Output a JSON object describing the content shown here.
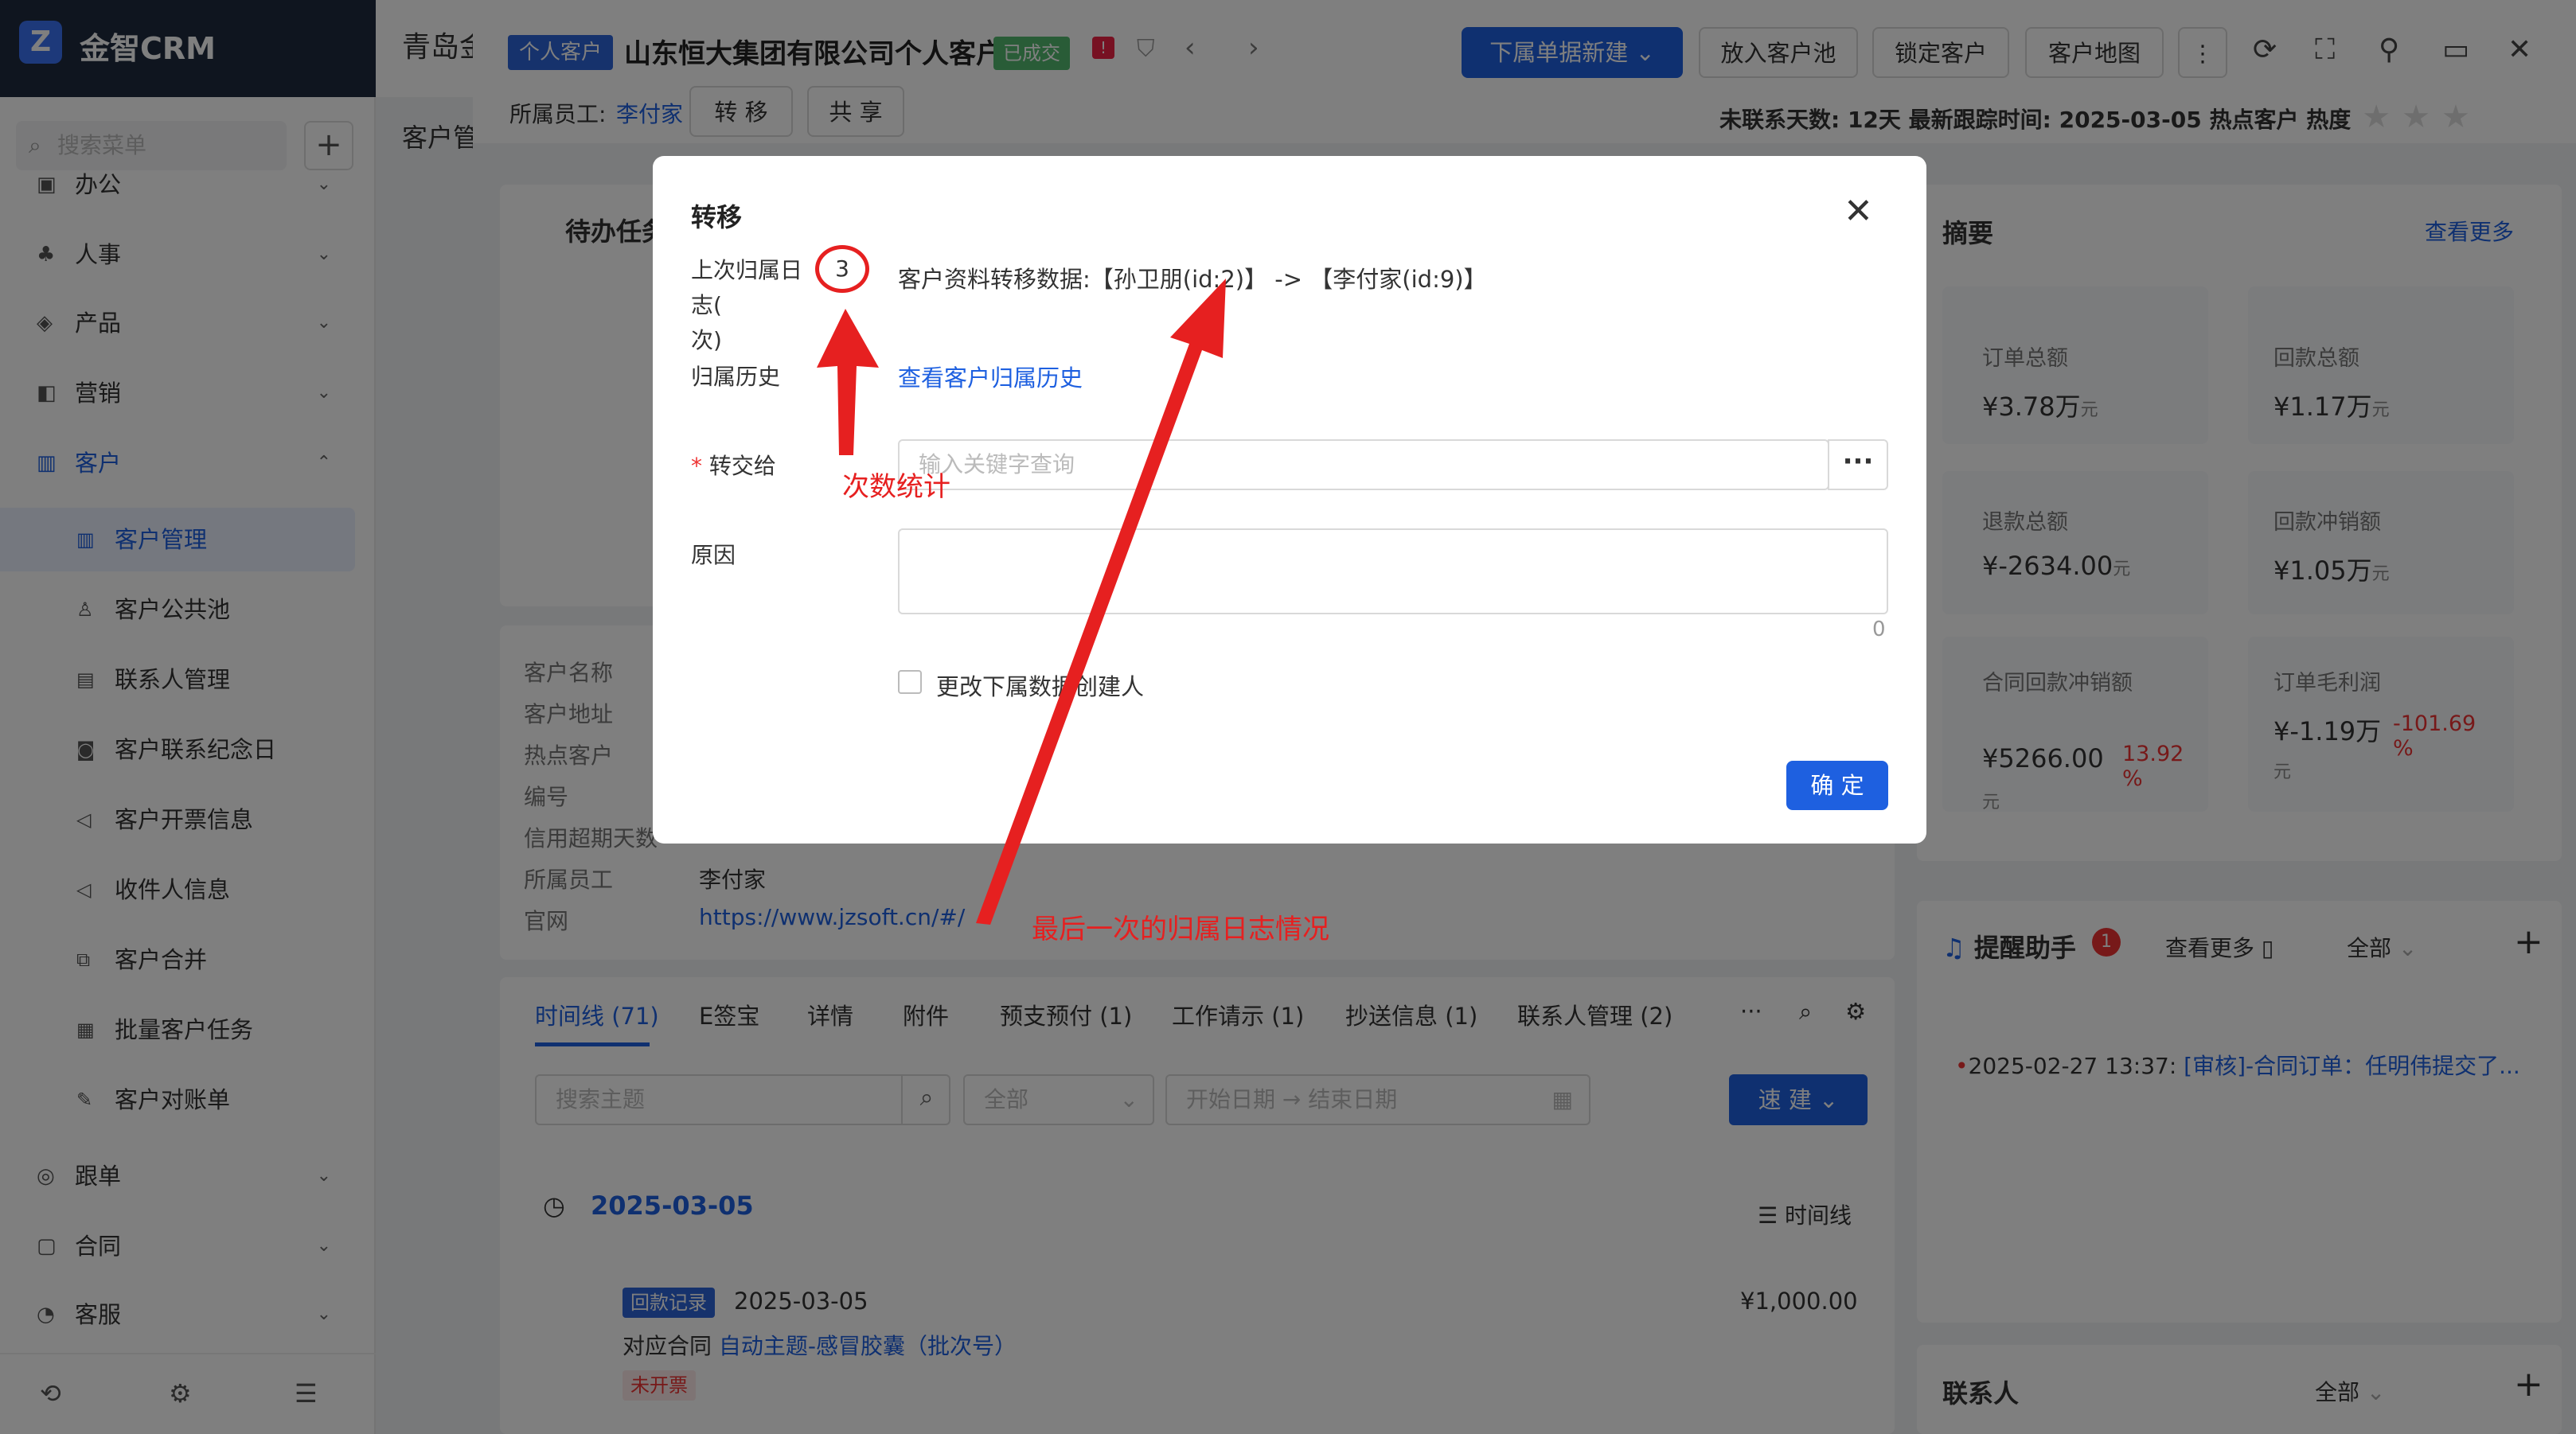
{
  "sidebar": {
    "brand": "金智CRM",
    "search_placeholder": "搜索菜单",
    "items": [
      {
        "label": "办公",
        "icon": "briefcase-icon"
      },
      {
        "label": "人事",
        "icon": "users-icon"
      },
      {
        "label": "产品",
        "icon": "box-icon"
      },
      {
        "label": "营销",
        "icon": "megaphone-icon"
      },
      {
        "label": "客户",
        "icon": "chart-icon"
      },
      {
        "label": "跟单",
        "icon": "target-icon"
      },
      {
        "label": "合同",
        "icon": "document-icon"
      },
      {
        "label": "客服",
        "icon": "headset-icon"
      }
    ],
    "sub_items": [
      {
        "label": "客户管理"
      },
      {
        "label": "客户公共池"
      },
      {
        "label": "联系人管理"
      },
      {
        "label": "客户联系纪念日"
      },
      {
        "label": "客户开票信息"
      },
      {
        "label": "收件人信息"
      },
      {
        "label": "客户合并"
      },
      {
        "label": "批量客户任务"
      },
      {
        "label": "客户对账单"
      }
    ]
  },
  "topbar": {
    "company": "青岛金",
    "breadcrumb": "客户管"
  },
  "drawer": {
    "tag_personal": "个人客户",
    "customer_name": "山东恒大集团有限公司个人客户",
    "tag_deal": "已成交",
    "buttons": {
      "new_sub": "下属单据新建",
      "to_pool": "放入客户池",
      "lock": "锁定客户",
      "map": "客户地图",
      "transfer": "转 移",
      "share": "共 享"
    },
    "employee_label": "所属员工:",
    "employee_name": "李付家",
    "stats": "未联系天数: 12天  最新跟踪时间: 2025-03-05",
    "hot_label": "热点客户",
    "heat_label": "热度",
    "todo_title": "待办任务",
    "info": [
      {
        "k": "客户名称",
        "v": ""
      },
      {
        "k": "客户地址",
        "v": ""
      },
      {
        "k": "热点客户",
        "v": ""
      },
      {
        "k": "编号",
        "v": ""
      },
      {
        "k": "信用超期天数",
        "v": ""
      },
      {
        "k": "所属员工",
        "v": "李付家"
      },
      {
        "k": "官网",
        "v": "https://www.jzsoft.cn/#/"
      }
    ],
    "tabs": [
      "时间线 (71)",
      "E签宝",
      "详情",
      "附件",
      "预支预付 (1)",
      "工作请示 (1)",
      "抄送信息 (1)",
      "联系人管理 (2)",
      "···"
    ],
    "timeline": {
      "search_placeholder": "搜索主题",
      "filter": "全部",
      "start_placeholder": "开始日期",
      "end_placeholder": "结束日期",
      "quick_btn": "速 建",
      "date": "2025-03-05",
      "view_label": "时间线",
      "record_tag": "回款记录",
      "record_date": "2025-03-05",
      "record_amount": "¥1,000.00",
      "contract_prefix": "对应合同",
      "contract_link": "自动主题-感冒胶囊（批次号）",
      "unbilled": "未开票"
    }
  },
  "summary": {
    "title": "摘要",
    "more": "查看更多",
    "cards": [
      {
        "k": "订单总额",
        "v": "¥3.78万",
        "unit": "元",
        "pct": ""
      },
      {
        "k": "回款总额",
        "v": "¥1.17万",
        "unit": "元",
        "pct": ""
      },
      {
        "k": "退款总额",
        "v": "¥-2634.00",
        "unit": "元",
        "pct": ""
      },
      {
        "k": "回款冲销额",
        "v": "¥1.05万",
        "unit": "元",
        "pct": ""
      },
      {
        "k": "合同回款冲销额",
        "v": "¥5266.00",
        "unit": "元",
        "pct": "13.92 %"
      },
      {
        "k": "订单毛利润",
        "v": "¥-1.19万",
        "unit": "元",
        "pct": "-101.69 %"
      }
    ]
  },
  "reminder": {
    "title": "提醒助手",
    "badge": "1",
    "more": "查看更多",
    "filter": "全部",
    "item_time": "2025-02-27 13:37:",
    "item_text": "[审核]-合同订单：任明伟提交了..."
  },
  "contacts": {
    "title": "联系人",
    "filter": "全部"
  },
  "modal": {
    "title": "转移",
    "last_log_label": "上次归属日志(",
    "last_log_suffix": "次)",
    "count": "3",
    "transfer_data": "客户资料转移数据:【孙卫朋(id:2)】 -> 【李付家(id:9)】",
    "history_label": "归属历史",
    "history_link": "查看客户归属历史",
    "to_label": "转交给",
    "to_placeholder": "输入关键字查询",
    "reason_label": "原因",
    "reason_count": "0",
    "checkbox_label": "更改下属数据创建人",
    "ok": "确 定"
  },
  "annotations": {
    "count_stat": "次数统计",
    "last_log": "最后一次的归属日志情况",
    "color": "#e62020"
  }
}
